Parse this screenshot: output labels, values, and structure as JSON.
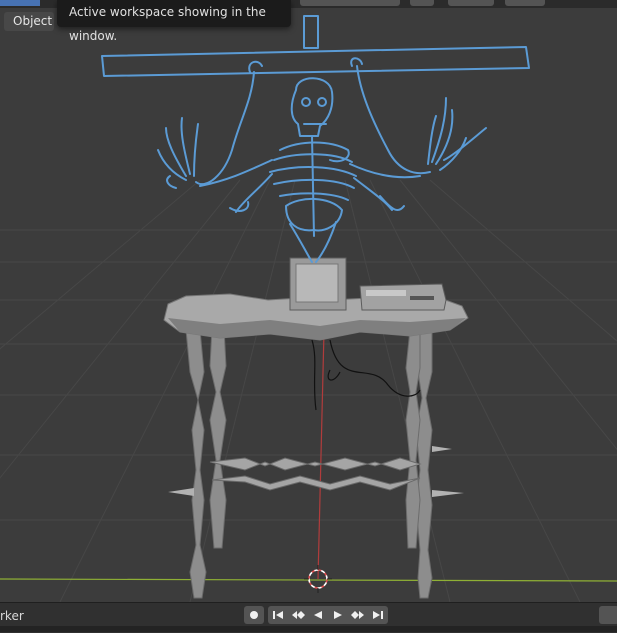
{
  "header": {
    "object_menu_label": "Object"
  },
  "tooltip": {
    "text": "Active workspace showing in the window."
  },
  "timeline": {
    "marker_label": "rker",
    "buttons": [
      {
        "name": "record-button",
        "icon": "record-icon"
      },
      {
        "name": "jump-to-start-button",
        "icon": "jump-start-icon"
      },
      {
        "name": "previous-keyframe-button",
        "icon": "prev-keyframe-icon"
      },
      {
        "name": "play-reverse-button",
        "icon": "play-reverse-icon"
      },
      {
        "name": "play-button",
        "icon": "play-icon"
      },
      {
        "name": "next-keyframe-button",
        "icon": "next-keyframe-icon"
      },
      {
        "name": "jump-to-end-button",
        "icon": "jump-end-icon"
      }
    ]
  },
  "colors": {
    "viewport_bg": "#3c3c3c",
    "grid_line": "#454545",
    "sketch_blue": "#5b9bd5",
    "x_axis": "#9bbd3a",
    "y_axis": "#b03a3a",
    "selection_accent": "#4772b3"
  }
}
